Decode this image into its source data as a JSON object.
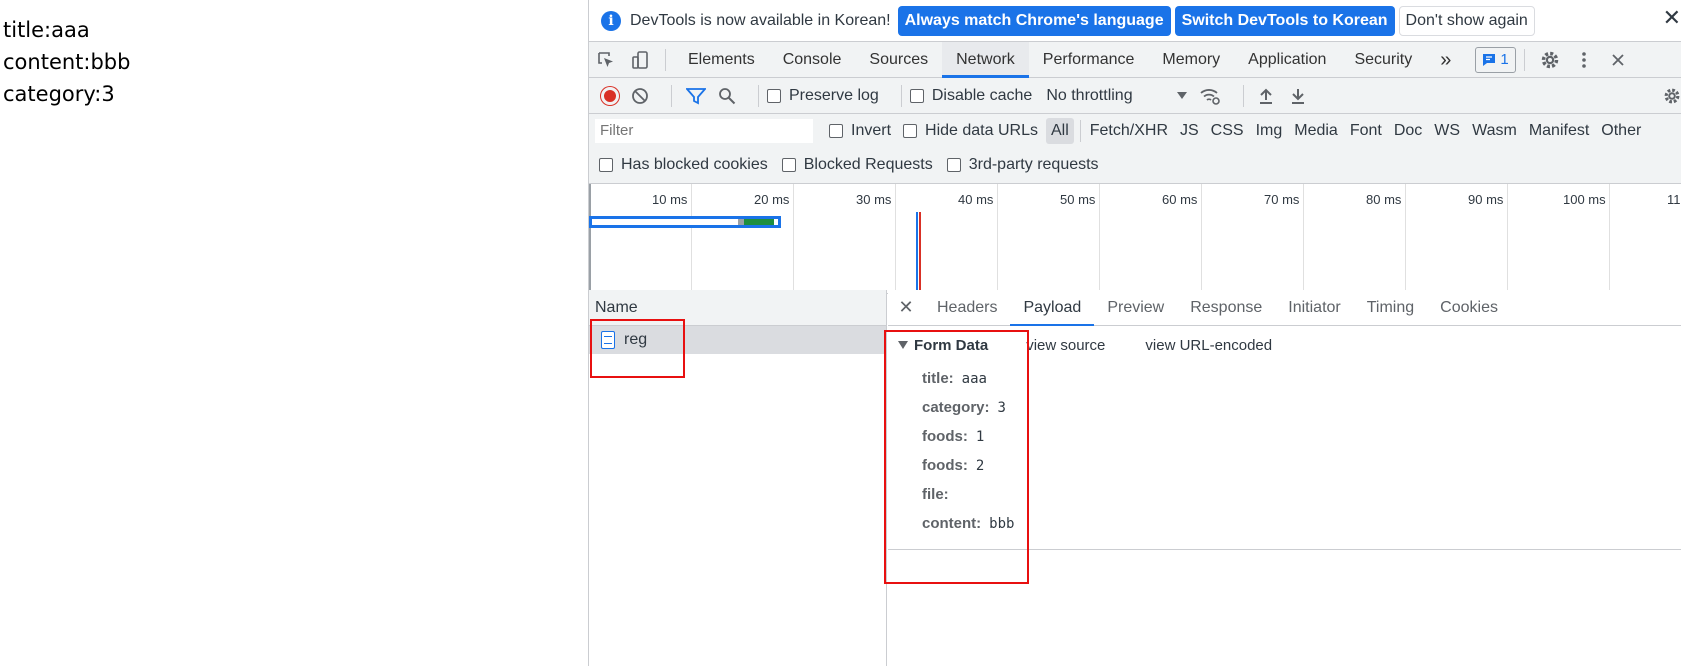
{
  "page": {
    "lines": [
      "title:aaa",
      "content:bbb",
      "category:3"
    ]
  },
  "infobar": {
    "icon": "info-icon",
    "message": "DevTools is now available in Korean!",
    "btn_match": "Always match Chrome's language",
    "btn_switch": "Switch DevTools to Korean",
    "btn_dont_show": "Don't show again",
    "close": "✕"
  },
  "tabs": [
    {
      "label": "Elements"
    },
    {
      "label": "Console"
    },
    {
      "label": "Sources"
    },
    {
      "label": "Network"
    },
    {
      "label": "Performance"
    },
    {
      "label": "Memory"
    },
    {
      "label": "Application"
    },
    {
      "label": "Security"
    }
  ],
  "tabs_more": "»",
  "issues_badge": "1",
  "toolbar": {
    "preserve_log": "Preserve log",
    "disable_cache": "Disable cache",
    "throttling": "No throttling"
  },
  "filter": {
    "placeholder": "Filter",
    "invert": "Invert",
    "hide_data_urls": "Hide data URLs",
    "types": [
      "All",
      "Fetch/XHR",
      "JS",
      "CSS",
      "Img",
      "Media",
      "Font",
      "Doc",
      "WS",
      "Wasm",
      "Manifest",
      "Other"
    ],
    "has_blocked_cookies": "Has blocked cookies",
    "blocked_requests": "Blocked Requests",
    "third_party": "3rd-party requests"
  },
  "timeline": {
    "ticks": [
      "10 ms",
      "20 ms",
      "30 ms",
      "40 ms",
      "50 ms",
      "60 ms",
      "70 ms",
      "80 ms",
      "90 ms",
      "100 ms",
      "11"
    ]
  },
  "requests": {
    "header": "Name",
    "rows": [
      {
        "name": "reg"
      }
    ]
  },
  "detail": {
    "close": "✕",
    "tabs": [
      "Headers",
      "Payload",
      "Preview",
      "Response",
      "Initiator",
      "Timing",
      "Cookies"
    ],
    "section_title": "Form Data",
    "view_source": "view source",
    "view_url_encoded": "view URL-encoded",
    "fields": [
      {
        "key": "title:",
        "value": "aaa"
      },
      {
        "key": "category:",
        "value": "3"
      },
      {
        "key": "foods:",
        "value": "1"
      },
      {
        "key": "foods:",
        "value": "2"
      },
      {
        "key": "file:",
        "value": ""
      },
      {
        "key": "content:",
        "value": "bbb"
      }
    ]
  },
  "colors": {
    "accent": "#1a73e8",
    "record": "#d93025",
    "annotation": "#e81010"
  }
}
